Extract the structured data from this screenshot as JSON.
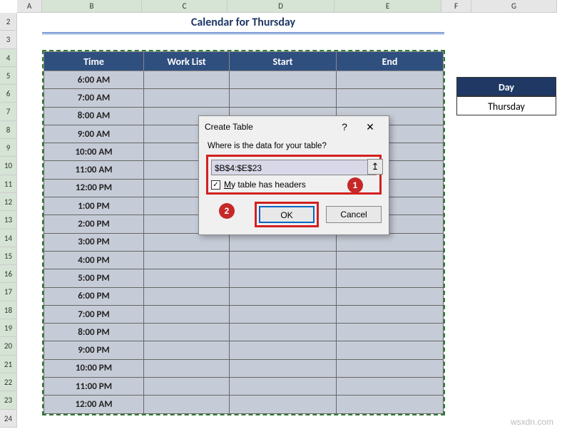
{
  "col_widths": {
    "A": 35,
    "B": 140,
    "C": 120,
    "D": 150,
    "E": 150,
    "F": 42,
    "G": 120
  },
  "columns": [
    "A",
    "B",
    "C",
    "D",
    "E",
    "F",
    "G"
  ],
  "rows": [
    2,
    3,
    4,
    5,
    6,
    7,
    8,
    9,
    10,
    11,
    12,
    13,
    14,
    15,
    16,
    17,
    18,
    19,
    20,
    21,
    22,
    23,
    24
  ],
  "selected_rows": [
    4,
    5,
    6,
    7,
    8,
    9,
    10,
    11,
    12,
    13,
    14,
    15,
    16,
    17,
    18,
    19,
    20,
    21,
    22,
    23
  ],
  "selected_cols": [
    "B",
    "C",
    "D",
    "E"
  ],
  "title": "Calendar for Thursday",
  "headers": [
    "Time",
    "Work List",
    "Start",
    "End"
  ],
  "times": [
    "6:00 AM",
    "7:00 AM",
    "8:00 AM",
    "9:00 AM",
    "10:00 AM",
    "11:00 AM",
    "12:00 PM",
    "1:00 PM",
    "2:00 PM",
    "3:00 PM",
    "4:00 PM",
    "5:00 PM",
    "6:00 PM",
    "7:00 PM",
    "8:00 PM",
    "9:00 PM",
    "10:00 PM",
    "11:00 PM",
    "12:00 AM"
  ],
  "day_header": "Day",
  "day_value": "Thursday",
  "dialog": {
    "title": "Create Table",
    "help": "?",
    "close": "✕",
    "prompt": "Where is the data for your table?",
    "range_value": "$B$4:$E$23",
    "ref_icon": "↥",
    "checkbox_checked": "✓",
    "checkbox_label_pre": "M",
    "checkbox_label_rest": "y table has headers",
    "badge1": "1",
    "badge2": "2",
    "ok": "OK",
    "cancel": "Cancel"
  },
  "watermark": "wsxdn.com"
}
